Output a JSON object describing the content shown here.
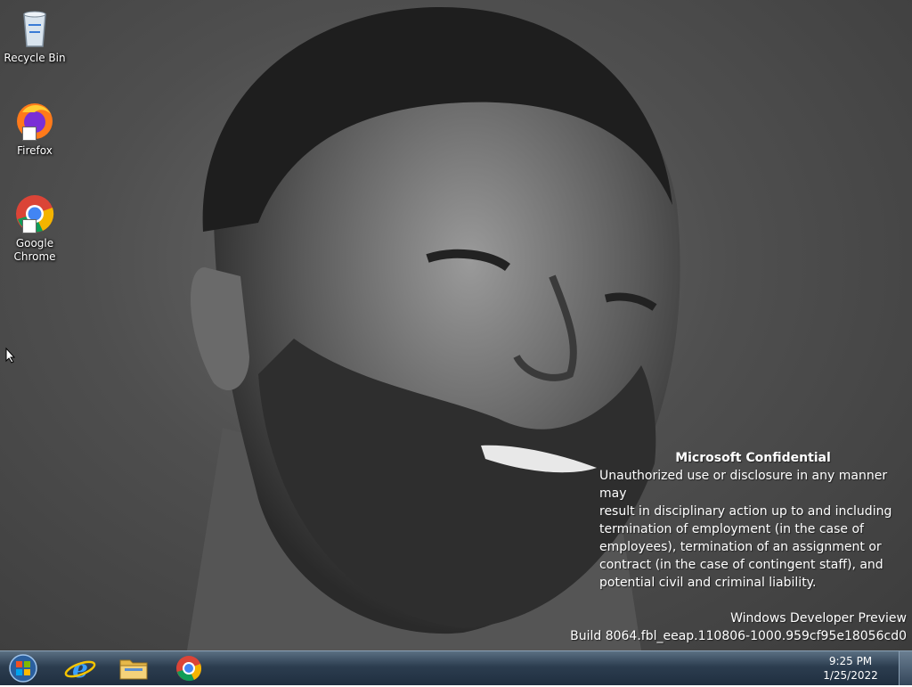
{
  "desktop": {
    "icons": [
      {
        "label": "Recycle Bin",
        "icon": "recycle-bin-icon"
      },
      {
        "label": "Firefox",
        "icon": "firefox-icon"
      },
      {
        "label": "Google Chrome",
        "icon": "chrome-icon"
      }
    ]
  },
  "watermark": {
    "title": "Microsoft Confidential",
    "lines": [
      "Unauthorized use or disclosure in any manner may",
      "result in disciplinary action up to and including",
      "termination of employment (in the case of",
      "employees), termination of an assignment or",
      "contract (in the case of contingent staff), and",
      "potential civil and criminal liability."
    ],
    "product": "Windows Developer Preview",
    "build": "Build 8064.fbl_eeap.110806-1000.959cf95e18056cd0"
  },
  "taskbar": {
    "start_icon": "windows-start-icon",
    "pinned": [
      "internet-explorer-icon",
      "file-explorer-icon",
      "chrome-icon"
    ],
    "clock": {
      "time": "9:25 PM",
      "date": "1/25/2022"
    }
  }
}
